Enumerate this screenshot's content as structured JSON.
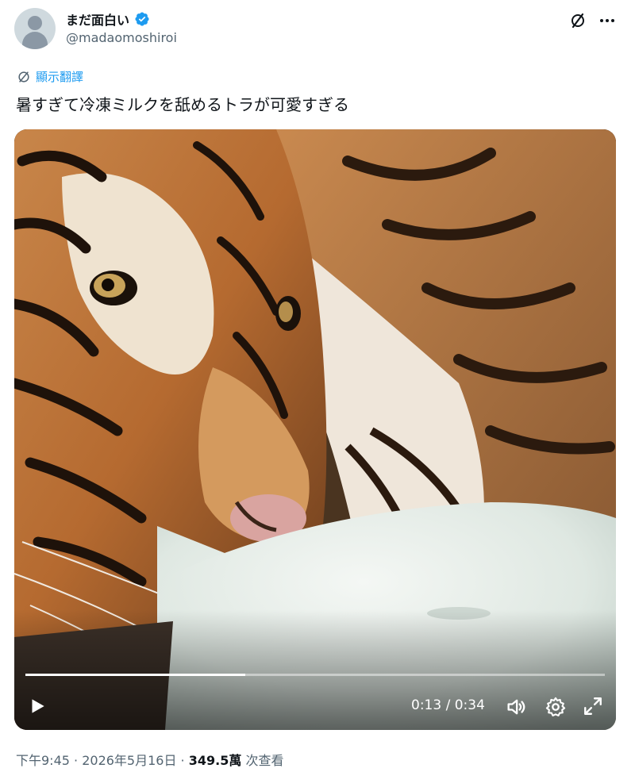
{
  "author": {
    "display_name": "まだ面白い",
    "handle": "@madaomoshiroi",
    "verified": true
  },
  "icons": {
    "avatar": "default-avatar-icon",
    "verified": "verified-badge-icon",
    "grok": "grok-icon",
    "more": "more-dots-icon",
    "translate": "globe-icon",
    "play": "play-icon",
    "volume": "volume-icon",
    "settings": "gear-icon",
    "fullscreen": "fullscreen-icon"
  },
  "translate_label": "顯示翻譯",
  "tweet_text": "暑すぎて冷凍ミルクを舐めるトラが可愛すぎる",
  "video": {
    "current_time": "0:13",
    "separator": " / ",
    "duration": "0:34",
    "progress_fraction": 0.38
  },
  "meta": {
    "time": "下午9:45",
    "dot1": " · ",
    "date": "2026年5月16日",
    "dot2": " · ",
    "views": "349.5萬",
    "views_label": " 次查看"
  },
  "colors": {
    "accent": "#1d9bf0",
    "secondary_text": "#536471",
    "primary_text": "#0f1419"
  }
}
